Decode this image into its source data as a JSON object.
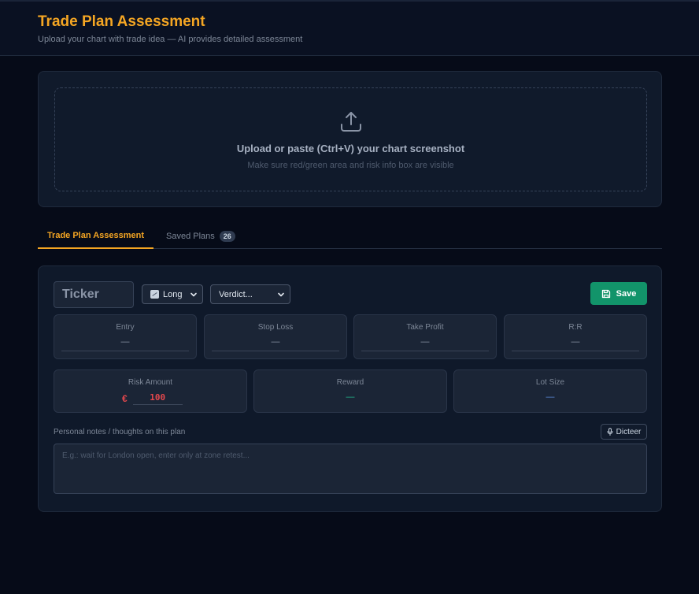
{
  "header": {
    "title": "Trade Plan Assessment",
    "subtitle": "Upload your chart with trade idea — AI provides detailed assessment"
  },
  "upload": {
    "title": "Upload or paste (Ctrl+V) your chart screenshot",
    "hint": "Make sure red/green area and risk info box are visible",
    "icon": "upload-icon"
  },
  "tabs": [
    {
      "label": "Trade Plan Assessment",
      "active": true
    },
    {
      "label": "Saved Plans",
      "badge": "26",
      "active": false
    }
  ],
  "plan": {
    "ticker_placeholder": "Ticker",
    "direction": "Long",
    "verdict": "Verdict...",
    "save_label": "Save",
    "fields": {
      "entry": {
        "label": "Entry",
        "value": "—"
      },
      "stop_loss": {
        "label": "Stop Loss",
        "value": "—"
      },
      "take_profit": {
        "label": "Take Profit",
        "value": "—"
      },
      "rr": {
        "label": "R:R",
        "value": "—"
      }
    },
    "risk": {
      "label": "Risk Amount",
      "currency": "€",
      "value": "100"
    },
    "reward": {
      "label": "Reward",
      "value": "—"
    },
    "lot": {
      "label": "Lot Size",
      "value": "—"
    },
    "notes_label": "Personal notes / thoughts on this plan",
    "dictate_label": "Dicteer",
    "notes_placeholder": "E.g.: wait for London open, enter only at zone retest..."
  },
  "colors": {
    "accent": "#f5a623",
    "save": "#12946a",
    "risk": "#e5484d",
    "reward": "#22b88a",
    "lot": "#5b8ad9",
    "background": "#060b18"
  }
}
